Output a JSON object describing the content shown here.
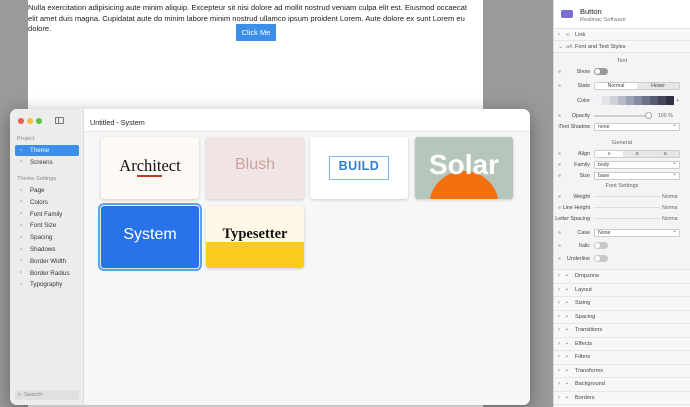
{
  "webpage": {
    "lorem_text": "Nulla exercitation adipisicing aute minim aliquip. Excepteur sit nisi dolore ad mollit nostrud veniam culpa elit est. Eiusmod occaecat elit amet duis magna. Cupidatat aute do minim labore minim nostrud ullamco ipsum proident Lorem. Aute dolore ex sunt Lorem eu dolore.",
    "button_label": "Click Me"
  },
  "dialog": {
    "title": "Untitled - System",
    "sidebar": {
      "project_heading": "Project",
      "project_items": [
        {
          "label": "Theme",
          "icon": "theme-icon"
        },
        {
          "label": "Screens",
          "icon": "screens-icon"
        }
      ],
      "settings_heading": "Theme Settings",
      "settings_items": [
        {
          "label": "Page",
          "icon": "page-icon"
        },
        {
          "label": "Colors",
          "icon": "colors-icon"
        },
        {
          "label": "Font Family",
          "icon": "font-family-icon"
        },
        {
          "label": "Font Size",
          "icon": "font-size-icon"
        },
        {
          "label": "Spacing",
          "icon": "spacing-icon"
        },
        {
          "label": "Shadows",
          "icon": "shadows-icon"
        },
        {
          "label": "Border Width",
          "icon": "border-width-icon"
        },
        {
          "label": "Border Radius",
          "icon": "border-radius-icon"
        },
        {
          "label": "Typography",
          "icon": "typography-icon"
        }
      ],
      "search_placeholder": "Search"
    },
    "themes": [
      {
        "name": "Architect",
        "bg": "#fdfaf6",
        "fg": "#111111",
        "accent": "#c0392b"
      },
      {
        "name": "Blush",
        "bg": "#f1e4e4",
        "fg": "#c9a2a2"
      },
      {
        "name": "BUILD",
        "bg": "#ffffff",
        "fg": "#2f7fd0"
      },
      {
        "name": "Solar",
        "bg": "#b7c6bb",
        "fg": "#ffffff",
        "accent": "#f3700f"
      },
      {
        "name": "System",
        "bg": "#2772e8",
        "fg": "#ffffff"
      },
      {
        "name": "Typesetter",
        "bg": "#fff8e6",
        "fg": "#111111",
        "accent": "#f8cb1d"
      }
    ]
  },
  "panel": {
    "component_title": "Button",
    "component_sub": "Realmac Software",
    "link_label": "Link",
    "font_section_label": "Font and Text Styles",
    "text_label": "Text",
    "show_label": "Show",
    "state_label": "State",
    "state_normal": "Normal",
    "state_hover": "Hover",
    "color_label": "Color",
    "opacity_label": "Opacity",
    "opacity_value": "100 %",
    "text_shadow_label": "Text Shadow",
    "text_shadow_value": "none",
    "general_label": "General",
    "align_label": "Align",
    "family_label": "Family",
    "family_value": "body",
    "size_label": "Size",
    "size_value": "base",
    "font_settings_label": "Font Settings",
    "weight_label": "Weight",
    "weight_value": "Norma",
    "line_height_label": "Line Height",
    "line_height_value": "Norma",
    "letter_spacing_label": "Letter Spacing",
    "letter_spacing_value": "Norma",
    "case_label": "Case",
    "case_value": "None",
    "italic_label": "Italic",
    "underline_label": "Underline",
    "sections": [
      "Dropzone",
      "Layout",
      "Sizing",
      "Spacing",
      "Transitions",
      "Effects",
      "Filters",
      "Transforms",
      "Background",
      "Borders"
    ],
    "swatch_colors": [
      "#f2f2f6",
      "#e2e3ea",
      "#cfd1dc",
      "#b8bbca",
      "#9ea2b5",
      "#858a9f",
      "#6d7288",
      "#575c70",
      "#434759",
      "#2e3142"
    ]
  }
}
